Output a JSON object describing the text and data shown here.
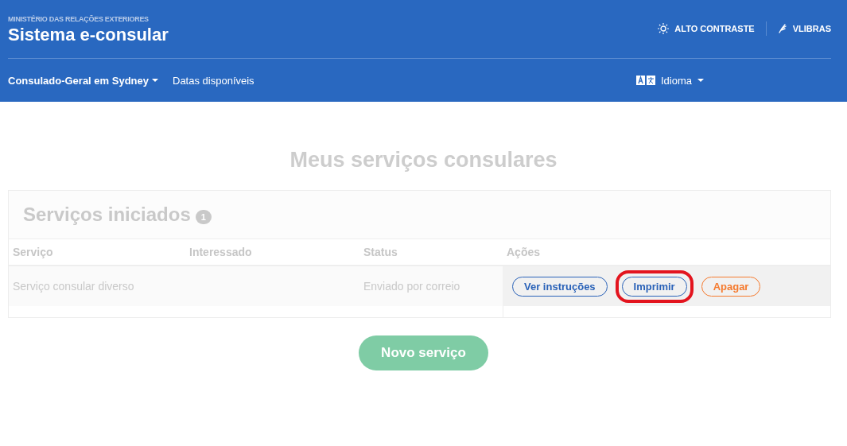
{
  "header": {
    "ministry": "MINISTÉRIO DAS RELAÇÕES EXTERIORES",
    "title": "Sistema e-consular",
    "accessibility": [
      {
        "kind": "contrast",
        "label": "ALTO CONTRASTE"
      },
      {
        "kind": "libras",
        "label": "VLIBRAS"
      }
    ],
    "nav": [
      {
        "label": "Consulado-Geral em Sydney",
        "dropdown": true,
        "bold": true
      },
      {
        "label": "Datas disponíveis",
        "dropdown": false,
        "bold": false
      }
    ],
    "language": {
      "label": "Idioma",
      "dropdown": true
    }
  },
  "page_title": "Meus serviços consulares",
  "services": {
    "title": "Serviços iniciados",
    "count": "1",
    "columns": [
      "Serviço",
      "Interessado",
      "Status",
      "Ações"
    ],
    "rows": [
      {
        "service": "Serviço consular diverso",
        "status": "Enviado por correio",
        "actions": [
          {
            "label": "Ver instruções",
            "kind": "primary",
            "highlighted": false
          },
          {
            "label": "Imprimir",
            "kind": "primary",
            "highlighted": true
          },
          {
            "label": "Apagar",
            "kind": "danger",
            "highlighted": false
          }
        ]
      }
    ]
  },
  "new_service_button": "Novo serviço"
}
